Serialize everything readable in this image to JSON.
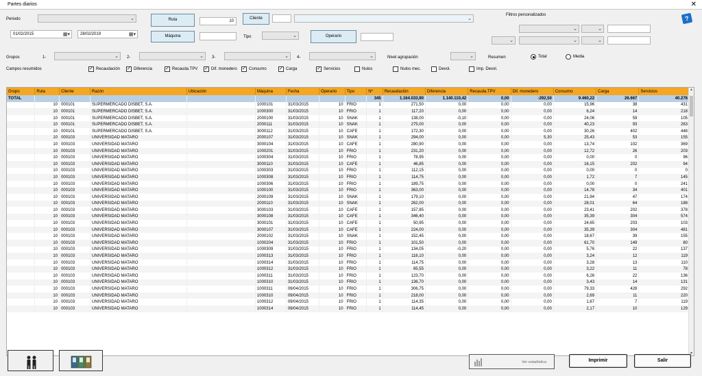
{
  "window": {
    "title": "Partes diarios",
    "close_glyph": "✕"
  },
  "filters": {
    "periodo_label": "Periodo",
    "date_from": "01/02/2015",
    "date_to": "28/02/2019",
    "ruta_button": "Ruta",
    "ruta_value": "10",
    "maquina_button": "Máquina",
    "tipo_label": "Tipo",
    "operario_button": "Operario",
    "cliente_button": "Cliente",
    "filtros_label": "Filtros personalizados",
    "grupos_label": "Grupos",
    "grupo_nums": [
      "1-",
      "2-",
      "3-",
      "4-"
    ],
    "nivel_label": "Nivel agrupación",
    "resumen_label": "Resumen",
    "resumen_options": [
      {
        "label": "Total",
        "selected": true
      },
      {
        "label": "Media",
        "selected": false
      }
    ],
    "campos_label": "Campos resumidos",
    "campos": [
      {
        "label": "Recaudación",
        "checked": true
      },
      {
        "label": "Diferencia",
        "checked": true
      },
      {
        "label": "Recauda.TPV",
        "checked": true
      },
      {
        "label": "Dif. monedero",
        "checked": true
      },
      {
        "label": "Consumo",
        "checked": true
      },
      {
        "label": "Carga",
        "checked": true
      },
      {
        "label": "Servicios",
        "checked": true
      },
      {
        "label": "Nulos",
        "checked": false
      },
      {
        "label": "Nulos mec.",
        "checked": false
      },
      {
        "label": "Devol.",
        "checked": false
      },
      {
        "label": "Imp. Devol.",
        "checked": false
      }
    ]
  },
  "grid": {
    "columns": [
      "Grupo",
      "Ruta",
      "Cliente",
      "Razón",
      "Ubicación",
      "Máquina",
      "Fecha",
      "Operario",
      "Tipo",
      "Nº",
      "Recaudación",
      "Diferencia",
      "Recauda.TPV",
      "Dif. monedero",
      "Consumo",
      "Carga",
      "Servicios"
    ],
    "total": [
      "TOTAL",
      "",
      "",
      "",
      "",
      "",
      "",
      "",
      "",
      "345",
      "1.164.033,90",
      "1.140.110,42",
      "0,00",
      "-292,50",
      "9.460,22",
      "26.667",
      "40.276"
    ],
    "rows": [
      [
        "",
        "10",
        "000101",
        "SUPERMERCADO DISBET, S.A.",
        "",
        "1000101",
        "31/03/2015",
        "10",
        "FRIO",
        "1",
        "271,50",
        "0,00",
        "0,00",
        "0,00",
        "15,96",
        "38",
        "431"
      ],
      [
        "",
        "10",
        "000101",
        "SUPERMERCADO DISBET, S.A.",
        "",
        "1000300",
        "31/03/2015",
        "10",
        "FRIO",
        "1",
        "117,20",
        "0,00",
        "0,00",
        "0,00",
        "6,24",
        "14",
        "218"
      ],
      [
        "",
        "10",
        "000101",
        "SUPERMERCADO DISBET, S.A.",
        "",
        "2000100",
        "31/03/2015",
        "10",
        "SNAK",
        "1",
        "138,00",
        "-0,10",
        "0,00",
        "0,00",
        "24,06",
        "59",
        "105"
      ],
      [
        "",
        "10",
        "000101",
        "SUPERMERCADO DISBET, S.A.",
        "",
        "2000111",
        "31/03/2015",
        "10",
        "SNAK",
        "1",
        "275,00",
        "0,00",
        "0,00",
        "0,00",
        "40,23",
        "93",
        "263"
      ],
      [
        "",
        "10",
        "000101",
        "SUPERMERCADO DISBET, S.A.",
        "",
        "3000112",
        "31/03/2015",
        "10",
        "CAFE",
        "1",
        "172,30",
        "0,00",
        "0,00",
        "0,00",
        "30,26",
        "402",
        "448"
      ],
      [
        "",
        "10",
        "000103",
        "UNIVERSIDAD MATARO",
        "",
        "2000107",
        "31/03/2015",
        "10",
        "SNAK",
        "1",
        "294,00",
        "0,00",
        "0,00",
        "5,30",
        "25,43",
        "53",
        "155"
      ],
      [
        "",
        "10",
        "000103",
        "UNIVERSIDAD MATARO",
        "",
        "3000104",
        "31/03/2015",
        "10",
        "CAFE",
        "1",
        "280,90",
        "0,00",
        "0,00",
        "0,00",
        "13,74",
        "102",
        "369"
      ],
      [
        "",
        "10",
        "000103",
        "UNIVERSIDAD MATARO",
        "",
        "1000201",
        "31/03/2015",
        "10",
        "FRIO",
        "1",
        "231,20",
        "0,00",
        "0,00",
        "0,00",
        "12,72",
        "26",
        "203"
      ],
      [
        "",
        "10",
        "000103",
        "UNIVERSIDAD MATARO",
        "",
        "1000304",
        "31/03/2015",
        "10",
        "FRIO",
        "1",
        "78,95",
        "0,00",
        "0,00",
        "0,00",
        "0,00",
        "0",
        "96"
      ],
      [
        "",
        "10",
        "000103",
        "UNIVERSIDAD MATARO",
        "",
        "3000110",
        "31/03/2015",
        "10",
        "CAFE",
        "1",
        "46,85",
        "0,00",
        "0,00",
        "0,00",
        "16,15",
        "202",
        "94"
      ],
      [
        "",
        "10",
        "000103",
        "UNIVERSIDAD MATARO",
        "",
        "1000303",
        "31/03/2015",
        "10",
        "FRIO",
        "1",
        "112,15",
        "0,00",
        "0,00",
        "0,00",
        "0,00",
        "0",
        "0"
      ],
      [
        "",
        "10",
        "000103",
        "UNIVERSIDAD MATARO",
        "",
        "1000308",
        "31/03/2015",
        "10",
        "FRIO",
        "1",
        "114,75",
        "0,00",
        "0,00",
        "0,00",
        "1,72",
        "7",
        "145"
      ],
      [
        "",
        "10",
        "000103",
        "UNIVERSIDAD MATARO",
        "",
        "1000306",
        "31/03/2015",
        "10",
        "FRIO",
        "1",
        "189,75",
        "0,00",
        "0,00",
        "0,00",
        "0,00",
        "0",
        "241"
      ],
      [
        "",
        "10",
        "000103",
        "UNIVERSIDAD MATARO",
        "",
        "1000100",
        "31/03/2015",
        "10",
        "FRIO",
        "1",
        "363,00",
        "0,00",
        "0,00",
        "0,00",
        "14,78",
        "34",
        "401"
      ],
      [
        "",
        "10",
        "000103",
        "UNIVERSIDAD MATARO",
        "",
        "2000109",
        "31/03/2015",
        "10",
        "SNAK",
        "1",
        "179,10",
        "0,00",
        "0,00",
        "0,00",
        "21,94",
        "47",
        "174"
      ],
      [
        "",
        "10",
        "000103",
        "UNIVERSIDAD MATARO",
        "",
        "2000110",
        "31/03/2015",
        "10",
        "SNAK",
        "1",
        "262,00",
        "0,00",
        "0,00",
        "0,00",
        "28,01",
        "64",
        "188"
      ],
      [
        "",
        "10",
        "000103",
        "UNIVERSIDAD MATARO",
        "",
        "3000103",
        "31/03/2015",
        "10",
        "CAFE",
        "1",
        "157,85",
        "0,00",
        "0,00",
        "0,00",
        "23,41",
        "202",
        "378"
      ],
      [
        "",
        "10",
        "000103",
        "UNIVERSIDAD MATARO",
        "",
        "3000108",
        "31/03/2015",
        "10",
        "CAFE",
        "1",
        "346,40",
        "0,00",
        "0,00",
        "0,00",
        "35,39",
        "304",
        "574"
      ],
      [
        "",
        "10",
        "000103",
        "UNIVERSIDAD MATARO",
        "",
        "3000101",
        "31/03/2015",
        "10",
        "CAFE",
        "1",
        "50,95",
        "0,00",
        "0,00",
        "0,00",
        "24,65",
        "203",
        "103"
      ],
      [
        "",
        "10",
        "000103",
        "UNIVERSIDAD MATARO",
        "",
        "3000107",
        "31/03/2015",
        "10",
        "CAFE",
        "1",
        "224,00",
        "0,00",
        "0,00",
        "0,00",
        "35,39",
        "304",
        "481"
      ],
      [
        "",
        "10",
        "000103",
        "UNIVERSIDAD MATARO",
        "",
        "2000102",
        "31/03/2015",
        "10",
        "SNAK",
        "1",
        "152,45",
        "0,00",
        "0,00",
        "0,00",
        "18,67",
        "39",
        "155"
      ],
      [
        "",
        "10",
        "000103",
        "UNIVERSIDAD MATARO",
        "",
        "1000204",
        "31/03/2015",
        "10",
        "FRIO",
        "1",
        "101,50",
        "0,00",
        "0,00",
        "0,00",
        "61,70",
        "149",
        "80"
      ],
      [
        "",
        "10",
        "000103",
        "UNIVERSIDAD MATARO",
        "",
        "1000309",
        "31/03/2015",
        "10",
        "FRIO",
        "1",
        "134,05",
        "-0,20",
        "0,00",
        "0,00",
        "5,76",
        "22",
        "137"
      ],
      [
        "",
        "10",
        "000103",
        "UNIVERSIDAD MATARO",
        "",
        "1000313",
        "31/03/2015",
        "10",
        "FRIO",
        "1",
        "116,10",
        "0,00",
        "0,00",
        "0,00",
        "3,24",
        "12",
        "119"
      ],
      [
        "",
        "10",
        "000103",
        "UNIVERSIDAD MATARO",
        "",
        "1000314",
        "31/03/2015",
        "10",
        "FRIO",
        "1",
        "114,75",
        "0,00",
        "0,00",
        "0,00",
        "3,28",
        "13",
        "110"
      ],
      [
        "",
        "10",
        "000103",
        "UNIVERSIDAD MATARO",
        "",
        "1000312",
        "31/03/2015",
        "10",
        "FRIO",
        "1",
        "65,55",
        "0,00",
        "0,00",
        "0,00",
        "3,22",
        "11",
        "78"
      ],
      [
        "",
        "10",
        "000103",
        "UNIVERSIDAD MATARO",
        "",
        "1000311",
        "31/03/2015",
        "10",
        "FRIO",
        "1",
        "123,70",
        "0,00",
        "0,00",
        "0,00",
        "6,26",
        "22",
        "136"
      ],
      [
        "",
        "10",
        "000103",
        "UNIVERSIDAD MATARO",
        "",
        "1000310",
        "31/03/2015",
        "10",
        "FRIO",
        "1",
        "136,70",
        "0,00",
        "0,00",
        "0,00",
        "3,43",
        "14",
        "131"
      ],
      [
        "",
        "10",
        "000103",
        "UNIVERSIDAD MATARO",
        "",
        "1000311",
        "09/04/2015",
        "10",
        "FRIO",
        "1",
        "306,75",
        "0,00",
        "0,00",
        "0,00",
        "79,33",
        "428",
        "292"
      ],
      [
        "",
        "10",
        "000103",
        "UNIVERSIDAD MATARO",
        "",
        "1000310",
        "09/04/2015",
        "10",
        "FRIO",
        "1",
        "218,00",
        "0,00",
        "0,00",
        "0,00",
        "2,69",
        "11",
        "220"
      ],
      [
        "",
        "10",
        "000103",
        "UNIVERSIDAD MATARO",
        "",
        "1000312",
        "09/04/2015",
        "10",
        "FRIO",
        "1",
        "114,35",
        "0,00",
        "0,00",
        "0,00",
        "1,67",
        "7",
        "119"
      ],
      [
        "",
        "10",
        "000103",
        "UNIVERSIDAD MATARO",
        "",
        "1000314",
        "09/04/2015",
        "10",
        "FRIO",
        "1",
        "114,45",
        "0,00",
        "0,00",
        "0,00",
        "2,17",
        "10",
        "129"
      ]
    ]
  },
  "bottom": {
    "ver_estadistica": "Ver estadística",
    "imprimir": "Imprimir",
    "salir": "Salir"
  },
  "colors": {
    "header_bg": "#f5a623",
    "total_bg": "#b9cfe6"
  }
}
